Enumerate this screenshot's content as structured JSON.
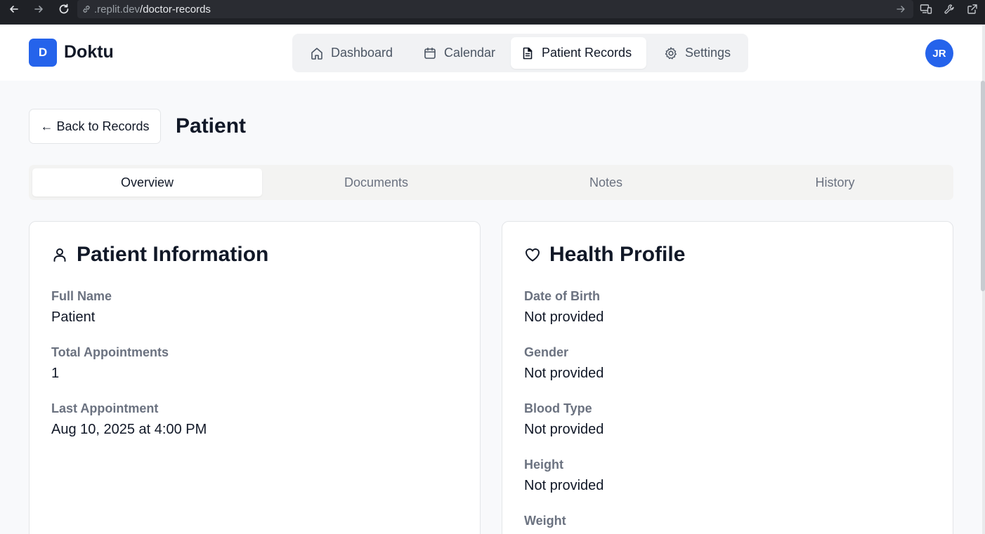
{
  "browser": {
    "url_domain": ".replit.dev",
    "url_path": "/doctor-records"
  },
  "app": {
    "logo_letter": "D",
    "name": "Doktu",
    "avatar_initials": "JR",
    "accent_color": "#2563eb"
  },
  "nav": {
    "items": [
      {
        "label": "Dashboard",
        "icon": "home-icon"
      },
      {
        "label": "Calendar",
        "icon": "calendar-icon"
      },
      {
        "label": "Patient Records",
        "icon": "document-icon",
        "active": true
      },
      {
        "label": "Settings",
        "icon": "gear-icon"
      }
    ]
  },
  "page": {
    "back_label": "← Back to Records",
    "title": "Patient"
  },
  "tabs": [
    {
      "label": "Overview",
      "active": true
    },
    {
      "label": "Documents"
    },
    {
      "label": "Notes"
    },
    {
      "label": "History"
    }
  ],
  "patient_info": {
    "title": "Patient Information",
    "fields": [
      {
        "label": "Full Name",
        "value": "Patient"
      },
      {
        "label": "Total Appointments",
        "value": "1"
      },
      {
        "label": "Last Appointment",
        "value": "Aug 10, 2025 at 4:00 PM"
      }
    ]
  },
  "health_profile": {
    "title": "Health Profile",
    "fields": [
      {
        "label": "Date of Birth",
        "value": "Not provided"
      },
      {
        "label": "Gender",
        "value": "Not provided"
      },
      {
        "label": "Blood Type",
        "value": "Not provided"
      },
      {
        "label": "Height",
        "value": "Not provided"
      },
      {
        "label": "Weight",
        "value": ""
      }
    ]
  }
}
